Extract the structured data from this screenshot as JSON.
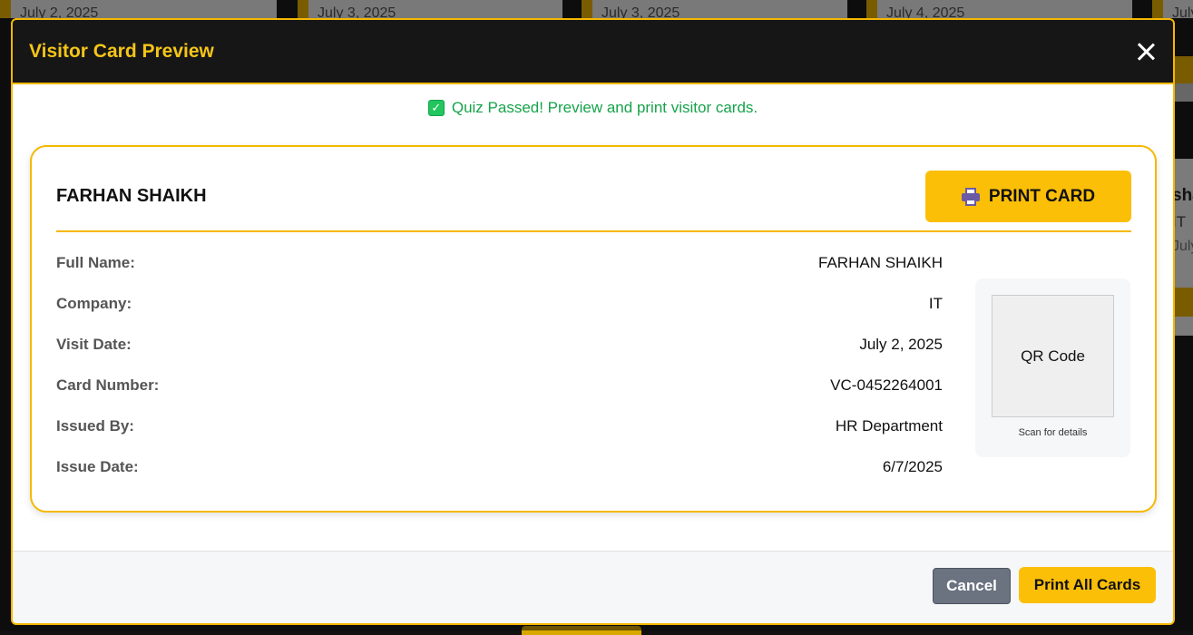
{
  "background": {
    "cards": [
      {
        "date": "July 2, 2025"
      },
      {
        "date": "July 3, 2025"
      },
      {
        "date": "July 3, 2025"
      },
      {
        "date": "July 4, 2025"
      },
      {
        "date": "July"
      }
    ],
    "side_card": {
      "name_fragment": "sha",
      "company_fragment": "IT",
      "date_fragment": "July"
    }
  },
  "modal": {
    "title": "Visitor Card Preview",
    "success_message": "Quiz Passed! Preview and print visitor cards.",
    "card": {
      "name": "FARHAN SHAIKH",
      "print_label": "PRINT CARD",
      "fields": [
        {
          "label": "Full Name:",
          "value": "FARHAN SHAIKH"
        },
        {
          "label": "Company:",
          "value": "IT"
        },
        {
          "label": "Visit Date:",
          "value": "July 2, 2025"
        },
        {
          "label": "Card Number:",
          "value": "VC-0452264001"
        },
        {
          "label": "Issued By:",
          "value": "HR Department"
        },
        {
          "label": "Issue Date:",
          "value": "6/7/2025"
        }
      ],
      "qr_label": "QR Code",
      "qr_caption": "Scan for details"
    },
    "footer": {
      "cancel_label": "Cancel",
      "print_all_label": "Print All Cards"
    }
  },
  "colors": {
    "accent": "#f5b800",
    "header_bg": "#161616",
    "title": "#f5c518",
    "success": "#16a34a",
    "cancel_bg": "#6b7280"
  },
  "icons": [
    "check-icon",
    "close-icon",
    "printer-icon"
  ]
}
